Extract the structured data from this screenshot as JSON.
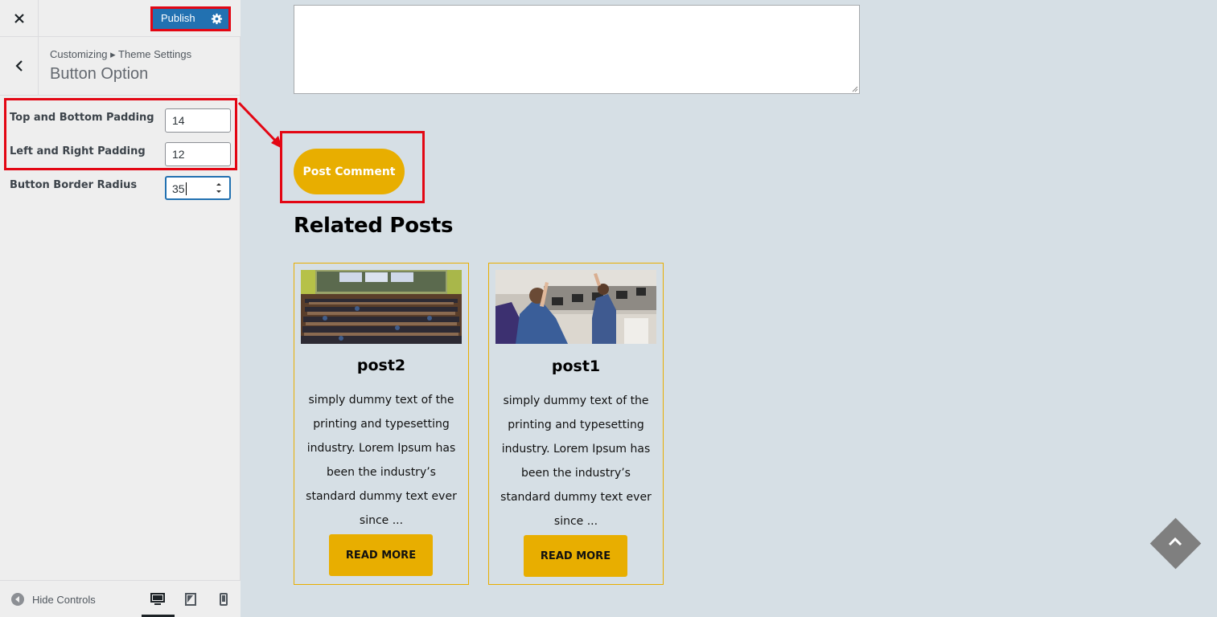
{
  "topbar": {
    "close_icon": "close-icon",
    "publish_label": "Publish",
    "publish_gear_icon": "gear-icon"
  },
  "section": {
    "breadcrumb": "Customizing ▸ Theme Settings",
    "title": "Button Option"
  },
  "fields": [
    {
      "label": "Top and Bottom Padding",
      "value": "14"
    },
    {
      "label": "Left and Right Padding",
      "value": "12"
    },
    {
      "label": "Button Border Radius",
      "value": "35"
    }
  ],
  "footer": {
    "hide_controls_label": "Hide Controls",
    "devices": [
      "desktop-icon",
      "tablet-icon",
      "mobile-icon"
    ]
  },
  "preview": {
    "comment_textarea_value": "",
    "post_comment_label": "Post Comment",
    "related_posts_title": "Related Posts",
    "posts": [
      {
        "title": "post2",
        "excerpt": [
          "simply dummy text of the",
          "printing and typesetting",
          "industry. Lorem Ipsum has",
          "been the industry’s",
          "standard dummy text ever",
          "since ..."
        ],
        "read_more": "READ MORE"
      },
      {
        "title": "post1",
        "excerpt": [
          "simply dummy text of the",
          "printing and typesetting",
          "industry. Lorem Ipsum has",
          "been the industry’s",
          "standard dummy text ever",
          "since ..."
        ],
        "read_more": "READ MORE"
      }
    ]
  },
  "colors": {
    "accent": "#e8ae00",
    "publish_blue": "#2271b1",
    "highlight_red": "#e30613",
    "preview_bg": "#d6dfe5"
  }
}
